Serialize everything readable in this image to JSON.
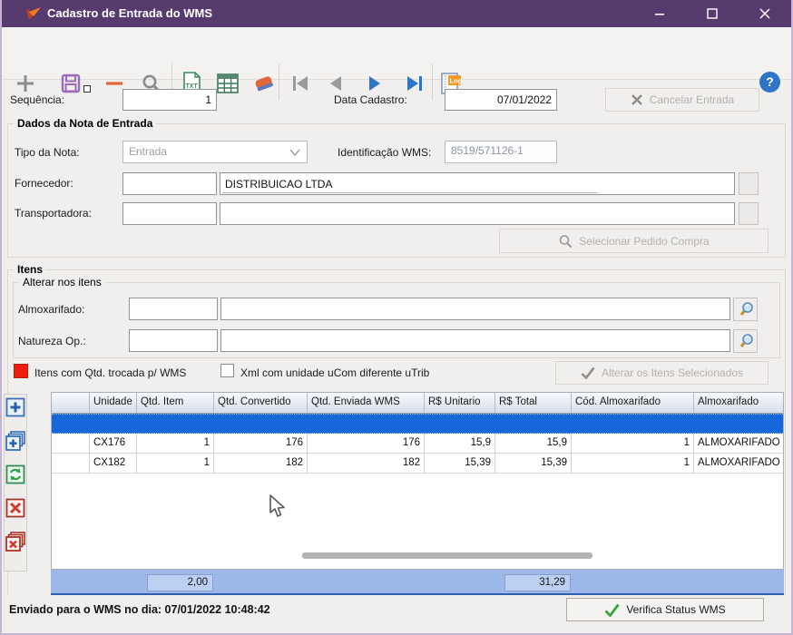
{
  "window": {
    "title": "Cadastro de Entrada do WMS"
  },
  "icons": {
    "help_glyph": "?",
    "txt_label": "TXT",
    "log_label": "Log"
  },
  "header_fields": {
    "sequencia_label": "Sequência:",
    "sequencia_value": "1",
    "data_cadastro_label": "Data Cadastro:",
    "data_cadastro_value": "07/01/2022",
    "cancelar_entrada": "Cancelar Entrada"
  },
  "dados_nota": {
    "title": "Dados da Nota de Entrada",
    "tipo_label": "Tipo da Nota:",
    "tipo_value": "Entrada",
    "ident_label": "Identificação WMS:",
    "ident_value": "8519/571126-1",
    "fornecedor_label": "Fornecedor:",
    "fornecedor_code": "",
    "fornecedor_name": "DISTRIBUICAO LTDA",
    "transportadora_label": "Transportadora:",
    "transportadora_code": "",
    "transportadora_name": "",
    "selecionar_pedido": "Selecionar Pedido Compra"
  },
  "itens": {
    "title": "Itens",
    "alterar_group": "Alterar nos itens",
    "almoxarifado_label": "Almoxarifado:",
    "almoxarifado_code": "",
    "almoxarifado_name": "",
    "natureza_label": "Natureza Op.:",
    "natureza_code": "",
    "natureza_name": "",
    "legend_qtd_trocada": "Itens com Qtd. trocada p/ WMS",
    "xml_checkbox_label": "Xml com unidade uCom diferente uTrib",
    "alterar_itens_btn": "Alterar os Itens Selecionados"
  },
  "grid": {
    "columns": [
      "",
      "Unidade",
      "Qtd. Item",
      "Qtd. Convertido",
      "Qtd. Enviada WMS",
      "R$ Unitario",
      "R$ Total",
      "Cód. Almoxarifado",
      "Almoxarifado"
    ],
    "rows": [
      {
        "unidade": "CX176",
        "qtd_item": "1",
        "qtd_convertido": "176",
        "qtd_enviada": "176",
        "unitario": "15,9",
        "total": "15,9",
        "cod_almox": "1",
        "almoxarifado": "ALMOXARIFADO"
      },
      {
        "unidade": "CX182",
        "qtd_item": "1",
        "qtd_convertido": "182",
        "qtd_enviada": "182",
        "unitario": "15,39",
        "total": "15,39",
        "cod_almox": "1",
        "almoxarifado": "ALMOXARIFADO"
      }
    ],
    "totals": {
      "qtd_item": "2,00",
      "total": "31,29"
    }
  },
  "statusbar": {
    "sent_text": "Enviado para o WMS no dia: 07/01/2022 10:48:42",
    "verifica_btn": "Verifica Status WMS"
  },
  "colors": {
    "titlebar": "#573a6e",
    "selected_row": "#1668da",
    "totals_band": "#9cb8e8",
    "legend_red": "#ee1c0c",
    "accent_blue": "#2e75c8"
  }
}
